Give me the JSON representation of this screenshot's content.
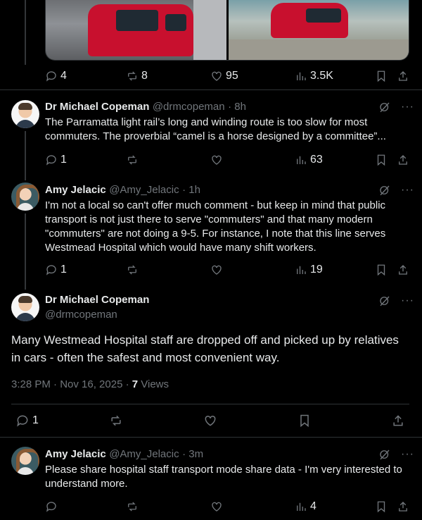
{
  "tweet0": {
    "replies": "4",
    "reposts": "8",
    "likes": "95",
    "views": "3.5K"
  },
  "reply1": {
    "name": "Dr Michael Copeman",
    "handle": "@drmcopeman",
    "time": "· 8h",
    "text": "The Parramatta light rail’s long and winding route is too slow for most commuters.  The proverbial “camel is a horse designed by a committee”...",
    "replies": "1",
    "views": "63"
  },
  "reply2": {
    "name": "Amy Jelacic",
    "handle": "@Amy_Jelacic",
    "time": "· 1h",
    "text": "I'm not a local so can't offer much comment - but keep in mind that public transport is not just there to serve \"commuters\" and that many modern \"commuters\" are not doing a 9-5. For instance, I note that this line serves Westmead Hospital which would have many shift workers.",
    "replies": "1",
    "views": "19"
  },
  "main": {
    "name": "Dr Michael Copeman",
    "handle": "@drmcopeman",
    "text": "Many Westmead Hospital staff are dropped off and picked up by relatives in cars - often the safest and most convenient way.",
    "timestamp": "3:28 PM · Nov 16, 2025 · ",
    "views_count": "7",
    "views_label": " Views",
    "replies": "1"
  },
  "reply3": {
    "name": "Amy Jelacic",
    "handle": "@Amy_Jelacic",
    "time": "· 3m",
    "text": "Please share hospital staff transport mode share data - I'm very interested to understand more.",
    "views": "4"
  }
}
